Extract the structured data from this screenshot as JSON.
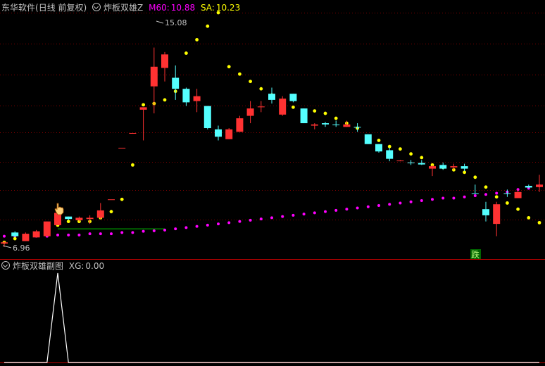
{
  "header": {
    "stock": "东华软件",
    "period": "(日线 前复权)",
    "indicator": "炸板双雄Z",
    "m60_label": "M60:",
    "m60_value": "10.88",
    "sa_label": "SA:",
    "sa_value": "10.23"
  },
  "subpanel": {
    "title": "炸板双雄副图",
    "xg_label": "XG:",
    "xg_value": "0.00"
  },
  "colors": {
    "up": "#ff3232",
    "down": "#54ffff",
    "m60": "#ff00ff",
    "sa": "#ffff00",
    "grid": "#800000",
    "level_line": "#00c000",
    "text": "#c0c0c0",
    "signal_box": "#006400"
  },
  "chart_data": {
    "type": "candlestick",
    "annotations": {
      "high_label": "15.08",
      "low_label": "6.96",
      "signal_text": "跌",
      "level_line_price": 7.7
    },
    "candles": [
      {
        "o": 7.1,
        "h": 7.2,
        "l": 6.96,
        "c": 7.15,
        "dir": "up"
      },
      {
        "o": 7.55,
        "h": 7.6,
        "l": 7.35,
        "c": 7.4,
        "dir": "down"
      },
      {
        "o": 7.2,
        "h": 7.55,
        "l": 7.2,
        "c": 7.5,
        "dir": "up"
      },
      {
        "o": 7.35,
        "h": 7.65,
        "l": 7.35,
        "c": 7.6,
        "dir": "up"
      },
      {
        "o": 7.4,
        "h": 8.0,
        "l": 7.4,
        "c": 8.0,
        "dir": "up"
      },
      {
        "o": 7.85,
        "h": 8.4,
        "l": 7.85,
        "c": 8.35,
        "dir": "up"
      },
      {
        "o": 8.2,
        "h": 8.2,
        "l": 8.05,
        "c": 8.1,
        "dir": "down"
      },
      {
        "o": 8.05,
        "h": 8.2,
        "l": 8.0,
        "c": 8.15,
        "dir": "up"
      },
      {
        "o": 8.1,
        "h": 8.25,
        "l": 7.9,
        "c": 8.15,
        "dir": "up"
      },
      {
        "o": 8.15,
        "h": 8.75,
        "l": 8.1,
        "c": 8.45,
        "dir": "up"
      },
      {
        "o": 8.9,
        "h": 8.9,
        "l": 8.9,
        "c": 8.9,
        "dir": "up"
      },
      {
        "o": 11.0,
        "h": 11.0,
        "l": 11.0,
        "c": 11.0,
        "dir": "up"
      },
      {
        "o": 11.6,
        "h": 11.6,
        "l": 11.6,
        "c": 11.6,
        "dir": "up"
      },
      {
        "o": 12.55,
        "h": 12.6,
        "l": 11.3,
        "c": 12.65,
        "dir": "up"
      },
      {
        "o": 13.5,
        "h": 15.08,
        "l": 12.4,
        "c": 14.3,
        "dir": "up"
      },
      {
        "o": 14.25,
        "h": 14.9,
        "l": 13.7,
        "c": 14.8,
        "dir": "up"
      },
      {
        "o": 13.85,
        "h": 14.35,
        "l": 12.95,
        "c": 13.4,
        "dir": "down"
      },
      {
        "o": 13.4,
        "h": 13.45,
        "l": 12.7,
        "c": 12.85,
        "dir": "down"
      },
      {
        "o": 12.9,
        "h": 13.4,
        "l": 12.45,
        "c": 13.1,
        "dir": "up"
      },
      {
        "o": 12.7,
        "h": 12.7,
        "l": 11.75,
        "c": 11.8,
        "dir": "down"
      },
      {
        "o": 11.75,
        "h": 11.9,
        "l": 11.3,
        "c": 11.45,
        "dir": "down"
      },
      {
        "o": 11.35,
        "h": 11.8,
        "l": 11.35,
        "c": 11.75,
        "dir": "up"
      },
      {
        "o": 11.65,
        "h": 12.3,
        "l": 11.65,
        "c": 12.2,
        "dir": "up"
      },
      {
        "o": 12.3,
        "h": 12.9,
        "l": 12.0,
        "c": 12.6,
        "dir": "up"
      },
      {
        "o": 12.65,
        "h": 12.9,
        "l": 12.45,
        "c": 12.68,
        "dir": "up"
      },
      {
        "o": 13.2,
        "h": 13.45,
        "l": 12.8,
        "c": 12.95,
        "dir": "down"
      },
      {
        "o": 12.35,
        "h": 13.1,
        "l": 12.3,
        "c": 13.0,
        "dir": "up"
      },
      {
        "o": 13.2,
        "h": 13.2,
        "l": 12.85,
        "c": 12.9,
        "dir": "down"
      },
      {
        "o": 12.6,
        "h": 12.6,
        "l": 12.0,
        "c": 12.0,
        "dir": "down"
      },
      {
        "o": 11.9,
        "h": 12.0,
        "l": 11.75,
        "c": 11.95,
        "dir": "up"
      },
      {
        "o": 12.0,
        "h": 12.05,
        "l": 11.85,
        "c": 11.95,
        "dir": "down"
      },
      {
        "o": 11.95,
        "h": 12.1,
        "l": 11.85,
        "c": 11.95,
        "dir": "down"
      },
      {
        "o": 11.85,
        "h": 12.1,
        "l": 11.85,
        "c": 11.95,
        "dir": "up"
      },
      {
        "o": 11.85,
        "h": 12.0,
        "l": 11.65,
        "c": 11.82,
        "dir": "down"
      },
      {
        "o": 11.55,
        "h": 11.55,
        "l": 11.15,
        "c": 11.15,
        "dir": "down"
      },
      {
        "o": 11.15,
        "h": 11.15,
        "l": 10.8,
        "c": 10.85,
        "dir": "down"
      },
      {
        "o": 10.9,
        "h": 11.0,
        "l": 10.45,
        "c": 10.55,
        "dir": "down"
      },
      {
        "o": 10.48,
        "h": 10.5,
        "l": 10.45,
        "c": 10.48,
        "dir": "up"
      },
      {
        "o": 10.4,
        "h": 10.5,
        "l": 10.3,
        "c": 10.38,
        "dir": "down"
      },
      {
        "o": 10.38,
        "h": 10.5,
        "l": 10.3,
        "c": 10.32,
        "dir": "down"
      },
      {
        "o": 10.15,
        "h": 10.3,
        "l": 9.85,
        "c": 10.25,
        "dir": "up"
      },
      {
        "o": 10.3,
        "h": 10.4,
        "l": 10.1,
        "c": 10.15,
        "dir": "down"
      },
      {
        "o": 10.2,
        "h": 10.35,
        "l": 10.1,
        "c": 10.25,
        "dir": "up"
      },
      {
        "o": 10.25,
        "h": 10.35,
        "l": 10.05,
        "c": 10.15,
        "dir": "down"
      },
      {
        "o": 9.15,
        "h": 9.5,
        "l": 9.15,
        "c": 9.15,
        "dir": "down"
      },
      {
        "o": 8.5,
        "h": 8.8,
        "l": 8.0,
        "c": 8.25,
        "dir": "down"
      },
      {
        "o": 7.9,
        "h": 8.8,
        "l": 7.4,
        "c": 8.7,
        "dir": "up"
      },
      {
        "o": 9.15,
        "h": 9.3,
        "l": 9.0,
        "c": 9.15,
        "dir": "down"
      },
      {
        "o": 8.95,
        "h": 9.3,
        "l": 8.95,
        "c": 9.2,
        "dir": "up"
      },
      {
        "o": 9.45,
        "h": 9.5,
        "l": 9.35,
        "c": 9.38,
        "dir": "down"
      },
      {
        "o": 9.4,
        "h": 9.9,
        "l": 9.2,
        "c": 9.5,
        "dir": "up"
      }
    ],
    "m60": [
      7.4,
      7.4,
      7.4,
      7.4,
      7.4,
      7.45,
      7.45,
      7.45,
      7.5,
      7.5,
      7.5,
      7.55,
      7.55,
      7.6,
      7.62,
      7.65,
      7.7,
      7.75,
      7.8,
      7.85,
      7.9,
      7.95,
      8.0,
      8.05,
      8.1,
      8.15,
      8.2,
      8.25,
      8.3,
      8.35,
      8.4,
      8.45,
      8.5,
      8.55,
      8.6,
      8.65,
      8.7,
      8.75,
      8.8,
      8.85,
      8.9,
      8.95,
      8.95,
      9.0,
      9.05,
      9.1,
      9.15,
      9.2,
      9.3,
      9.35,
      9.45
    ],
    "sa": [
      7.15,
      7.3,
      7.4,
      7.5,
      7.6,
      7.85,
      8.0,
      8.0,
      8.0,
      8.15,
      8.4,
      8.9,
      10.3,
      12.75,
      12.8,
      12.95,
      13.3,
      14.85,
      15.4,
      15.95,
      16.5,
      14.3,
      14.0,
      13.7,
      13.4,
      13.15,
      12.8,
      12.65,
      12.5,
      12.5,
      12.4,
      12.2,
      12.0,
      11.8,
      11.45,
      11.3,
      11.05,
      10.95,
      10.75,
      10.6,
      10.3,
      10.2,
      10.1,
      10.0,
      9.8,
      9.4,
      9.0,
      8.75,
      8.5,
      8.15,
      7.95
    ],
    "xg": [
      0,
      0,
      0,
      0,
      0,
      1,
      0,
      0,
      0,
      0,
      0,
      0,
      0,
      0,
      0,
      0,
      0,
      0,
      0,
      0,
      0,
      0,
      0,
      0,
      0,
      0,
      0,
      0,
      0,
      0,
      0,
      0,
      0,
      0,
      0,
      0,
      0,
      0,
      0,
      0,
      0,
      0,
      0,
      0,
      0,
      0,
      0,
      0,
      0,
      0,
      0
    ]
  }
}
